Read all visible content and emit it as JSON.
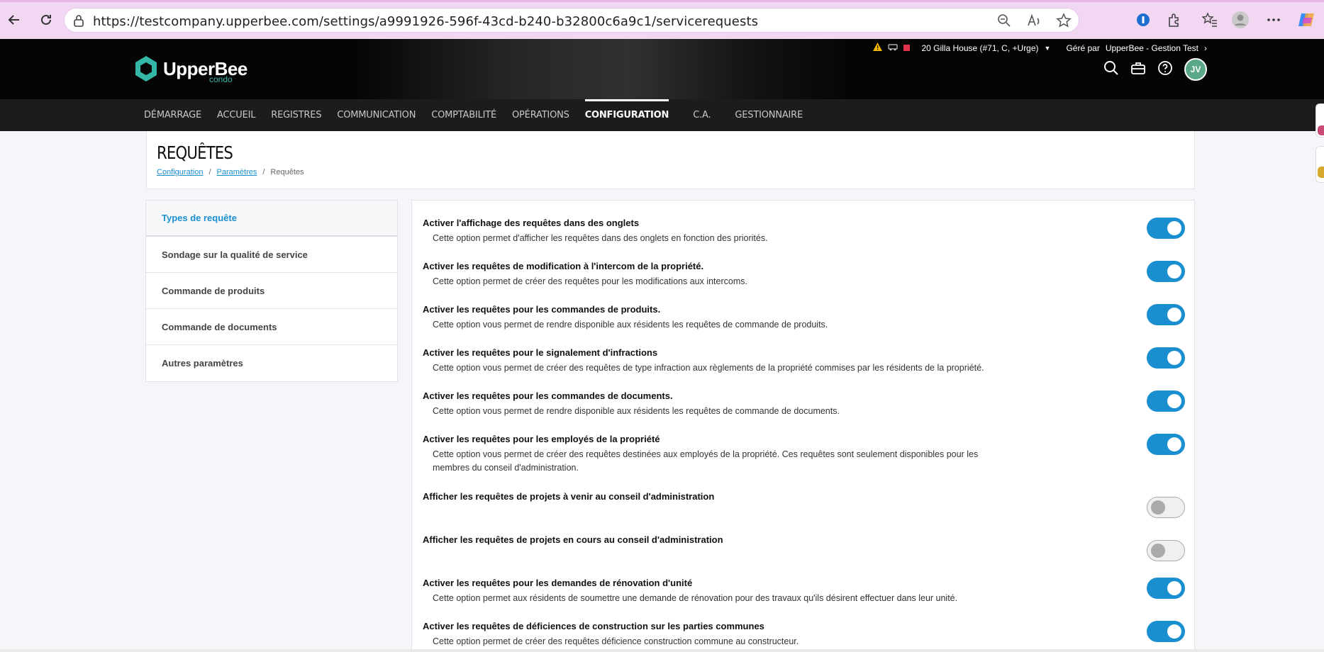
{
  "browser": {
    "url": "https://testcompany.upperbee.com/settings/a9991926-596f-43cd-b240-b32800c6a9c1/servicerequests"
  },
  "header": {
    "logo_text": "UpperBee",
    "logo_sub": "condo",
    "property": "20 Gilla House (#71, C, +Urge)",
    "managed_by_label": "Géré par",
    "managed_by": "UpperBee - Gestion Test",
    "avatar_initials": "JV"
  },
  "nav": {
    "items": [
      "Démarrage",
      "Accueil",
      "Registres",
      "Communication",
      "Comptabilité",
      "Opérations",
      "Configuration",
      "C.A.",
      "Gestionnaire"
    ],
    "active": "Configuration"
  },
  "page": {
    "title": "REQUÊTES",
    "breadcrumb": [
      "Configuration",
      "Paramètres",
      "Requêtes"
    ]
  },
  "sidebar": {
    "items": [
      "Types de requête",
      "Sondage sur la qualité de service",
      "Commande de produits",
      "Commande de documents",
      "Autres paramètres"
    ]
  },
  "settings": [
    {
      "title": "Activer l'affichage des requêtes dans des onglets",
      "desc": "Cette option permet d'afficher les requêtes dans des onglets en fonction des priorités.",
      "enabled": true
    },
    {
      "title": "Activer les requêtes de modification à l'intercom de la propriété.",
      "desc": "Cette option permet de créer des requêtes pour les modifications aux intercoms.",
      "enabled": true
    },
    {
      "title": "Activer les requêtes pour les commandes de produits.",
      "desc": "Cette option vous permet de rendre disponible aux résidents les requêtes de commande de produits.",
      "enabled": true
    },
    {
      "title": "Activer les requêtes pour le signalement d'infractions",
      "desc": "Cette option vous permet de créer des requêtes de type infraction aux règlements de la propriété commises par les résidents de la propriété.",
      "enabled": true
    },
    {
      "title": "Activer les requêtes pour les commandes de documents.",
      "desc": "Cette option vous permet de rendre disponible aux résidents les requêtes de commande de documents.",
      "enabled": true
    },
    {
      "title": "Activer les requêtes pour les employés de la propriété",
      "desc": "Cette option vous permet de créer des requêtes destinées aux employés de la propriété. Ces requêtes sont seulement disponibles pour les membres du conseil d'administration.",
      "enabled": true
    },
    {
      "title": "Afficher les requêtes de projets à venir au conseil d'administration",
      "desc": "",
      "enabled": false
    },
    {
      "title": "Afficher les requêtes de projets en cours au conseil d'administration",
      "desc": "",
      "enabled": false
    },
    {
      "title": "Activer les requêtes pour les demandes de rénovation d'unité",
      "desc": "Cette option permet aux résidents de soumettre une demande de rénovation pour des travaux qu'ils désirent effectuer dans leur unité.",
      "enabled": true
    },
    {
      "title": "Activer les requêtes de déficiences de construction sur les parties communes",
      "desc": "Cette option permet de créer des requêtes déficience construction commune au constructeur.",
      "enabled": true
    }
  ],
  "colors": {
    "accent": "#1a8fd0",
    "brand_teal": "#35b7a7",
    "header_bg": "#050505",
    "nav_bg": "#1c1c1c"
  }
}
